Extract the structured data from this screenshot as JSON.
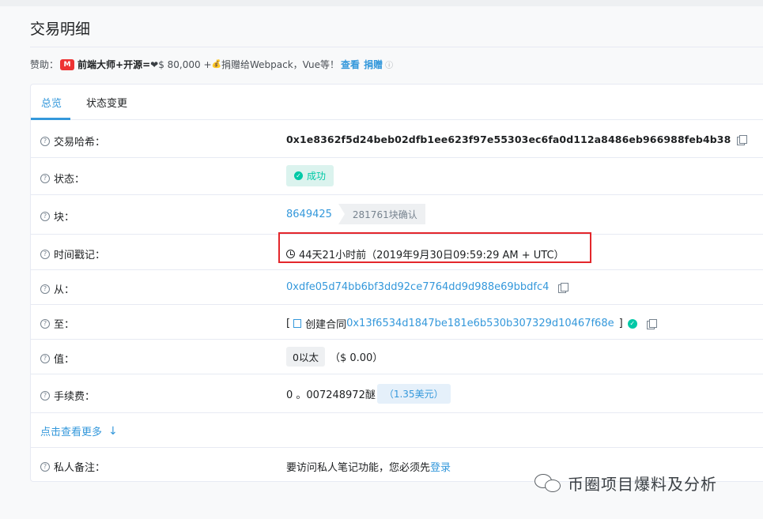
{
  "page": {
    "title": "交易明细"
  },
  "sponsor": {
    "prefix": "赞助：",
    "logo_text": "M",
    "headline": "前端大师+开源=",
    "heart": "❤",
    "amount_text": " $ 80,000 +",
    "bag": "💰",
    "description": "捐赠给Webpack，Vue等！",
    "view_link": "查看",
    "donate_link": "捐赠",
    "info_glyph": "ⓘ"
  },
  "tabs": [
    {
      "label": "总览",
      "active": true
    },
    {
      "label": "状态变更",
      "active": false
    }
  ],
  "rows": {
    "tx_hash": {
      "label": "交易哈希：",
      "value": "0x1e8362f5d24beb02dfb1ee623f97e55303ec6fa0d112a8486eb966988feb4b38"
    },
    "status": {
      "label": "状态：",
      "value": "成功"
    },
    "block": {
      "label": "块：",
      "value": "8649425",
      "confirmations": "281761块确认"
    },
    "timestamp": {
      "label": "时间戳记：",
      "value": "44天21小时前（2019年9月30日09:59:29 AM + UTC）"
    },
    "from": {
      "label": "从：",
      "value": "0xdfe05d74bb6bf3dd92ce7764dd9d988e69bbdfc4"
    },
    "to": {
      "label": "至：",
      "bracket_open": "[",
      "prefix": "创建合同",
      "value": "0x13f6534d1847be181e6b530b307329d10467f68e",
      "bracket_close": "]"
    },
    "value": {
      "label": "值：",
      "amount": "0以太",
      "usd": "（$ 0.00）"
    },
    "fee": {
      "label": "手续费：",
      "amount": "0 。007248972醚",
      "usd": "（1.35美元）"
    },
    "more": {
      "label": "点击查看更多",
      "arrow": "↓"
    },
    "note": {
      "label": "私人备注：",
      "text": "要访问私人笔记功能，您必须先",
      "login_link": "登录"
    }
  },
  "icons": {
    "question": "?",
    "check": "✓"
  },
  "watermark": {
    "text": "币圈项目爆料及分析"
  },
  "colors": {
    "accent": "#3498db",
    "success": "#00c9a7",
    "highlight_border": "#e3262b"
  }
}
